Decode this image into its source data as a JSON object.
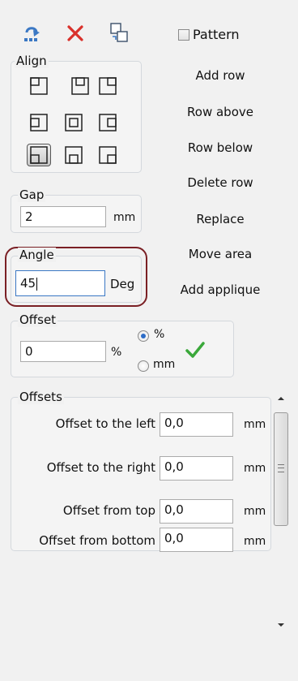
{
  "toolbar": {
    "pattern_label": "Pattern",
    "pattern_checked": false
  },
  "align": {
    "legend": "Align",
    "selected": "bottom-left"
  },
  "actions": {
    "add_row": "Add row",
    "row_above": "Row above",
    "row_below": "Row below",
    "delete_row": "Delete row",
    "replace": "Replace",
    "move_area": "Move area",
    "add_applique": "Add applique"
  },
  "gap": {
    "legend": "Gap",
    "value": "2",
    "unit": "mm"
  },
  "angle": {
    "legend": "Angle",
    "value": "45",
    "unit": "Deg"
  },
  "offset": {
    "legend": "Offset",
    "value": "0",
    "unit": "%",
    "radio_percent": "%",
    "radio_mm": "mm",
    "selected": "%"
  },
  "offsets": {
    "legend": "Offsets",
    "rows": [
      {
        "label": "Offset to the left",
        "value": "0,0",
        "unit": "mm"
      },
      {
        "label": "Offset to the right",
        "value": "0,0",
        "unit": "mm"
      },
      {
        "label": "Offset from top",
        "value": "0,0",
        "unit": "mm"
      },
      {
        "label": "Offset from bottom",
        "value": "0,0",
        "unit": "mm"
      }
    ]
  },
  "colors": {
    "highlight_border": "#7a1f24",
    "checkmark": "#3aa83a",
    "delete": "#d9312b",
    "icon_blue": "#3b78c4"
  }
}
